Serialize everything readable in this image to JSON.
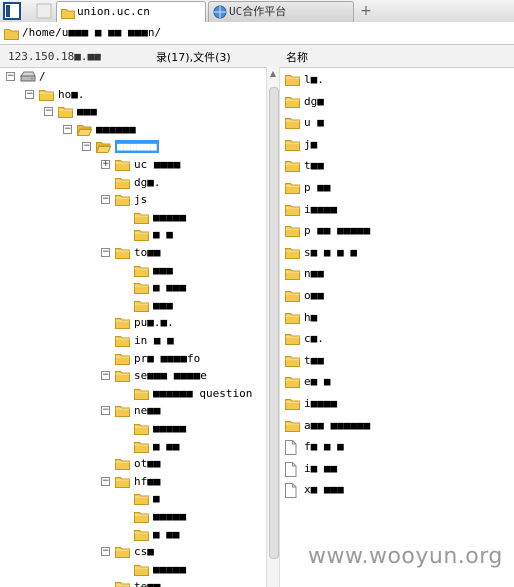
{
  "tabs": [
    {
      "label": "union.uc.cn",
      "active": true
    },
    {
      "label": "UC合作平台",
      "active": false
    }
  ],
  "new_tab_label": "+",
  "address": {
    "path": "/home/u■■■ ■ ■■ ■■■n/"
  },
  "header": {
    "ip": "123.150.18■.■■",
    "count_text": "录(17),文件(3)",
    "name_column": "名称"
  },
  "tree": [
    {
      "label": "/",
      "depth": 0,
      "toggle": "-",
      "kind": "drive"
    },
    {
      "label": "ho■.",
      "depth": 1,
      "toggle": "-",
      "kind": "folder"
    },
    {
      "label": "■■■",
      "depth": 2,
      "toggle": "-",
      "kind": "folder"
    },
    {
      "label": "■■■■■■",
      "depth": 3,
      "toggle": "-",
      "kind": "folder-open"
    },
    {
      "label": "■■■■■■",
      "depth": 4,
      "toggle": "-",
      "kind": "folder-open",
      "selected": true
    },
    {
      "label": "uc ■■■■",
      "depth": 5,
      "toggle": "+",
      "kind": "folder"
    },
    {
      "label": "dg■.",
      "depth": 5,
      "toggle": "",
      "kind": "folder"
    },
    {
      "label": "js",
      "depth": 5,
      "toggle": "-",
      "kind": "folder"
    },
    {
      "label": "■■■■■",
      "depth": 6,
      "toggle": "",
      "kind": "folder"
    },
    {
      "label": "■ ■",
      "depth": 6,
      "toggle": "",
      "kind": "folder"
    },
    {
      "label": "to■■",
      "depth": 5,
      "toggle": "-",
      "kind": "folder"
    },
    {
      "label": "■■■",
      "depth": 6,
      "toggle": "",
      "kind": "folder"
    },
    {
      "label": "■ ■■■",
      "depth": 6,
      "toggle": "",
      "kind": "folder"
    },
    {
      "label": "■■■",
      "depth": 6,
      "toggle": "",
      "kind": "folder"
    },
    {
      "label": "pu■.■.",
      "depth": 5,
      "toggle": "",
      "kind": "folder"
    },
    {
      "label": "in ■ ■",
      "depth": 5,
      "toggle": "",
      "kind": "folder"
    },
    {
      "label": "pr■ ■■■■fo",
      "depth": 5,
      "toggle": "",
      "kind": "folder"
    },
    {
      "label": "se■■■ ■■■■e",
      "depth": 5,
      "toggle": "-",
      "kind": "folder"
    },
    {
      "label": "■■■■■■ question",
      "depth": 6,
      "toggle": "",
      "kind": "folder"
    },
    {
      "label": "ne■■",
      "depth": 5,
      "toggle": "-",
      "kind": "folder"
    },
    {
      "label": "■■■■■",
      "depth": 6,
      "toggle": "",
      "kind": "folder"
    },
    {
      "label": "■ ■■",
      "depth": 6,
      "toggle": "",
      "kind": "folder"
    },
    {
      "label": "ot■■",
      "depth": 5,
      "toggle": "",
      "kind": "folder"
    },
    {
      "label": "hf■■",
      "depth": 5,
      "toggle": "-",
      "kind": "folder"
    },
    {
      "label": "■",
      "depth": 6,
      "toggle": "",
      "kind": "folder"
    },
    {
      "label": "■■■■■",
      "depth": 6,
      "toggle": "",
      "kind": "folder"
    },
    {
      "label": "■ ■■",
      "depth": 6,
      "toggle": "",
      "kind": "folder"
    },
    {
      "label": "cs■",
      "depth": 5,
      "toggle": "-",
      "kind": "folder"
    },
    {
      "label": "■■■■■",
      "depth": 6,
      "toggle": "",
      "kind": "folder"
    },
    {
      "label": "te■■",
      "depth": 5,
      "toggle": "",
      "kind": "folder"
    },
    {
      "label": "■■■■",
      "depth": 5,
      "toggle": "-",
      "kind": "folder"
    }
  ],
  "files": [
    {
      "label": "l■.",
      "kind": "folder"
    },
    {
      "label": "dg■",
      "kind": "folder"
    },
    {
      "label": "u ■",
      "kind": "folder"
    },
    {
      "label": "j■",
      "kind": "folder"
    },
    {
      "label": "t■■",
      "kind": "folder"
    },
    {
      "label": "p ■■",
      "kind": "folder"
    },
    {
      "label": "i■■■■",
      "kind": "folder"
    },
    {
      "label": "p ■■ ■■■■■",
      "kind": "folder"
    },
    {
      "label": "s■ ■ ■ ■",
      "kind": "folder"
    },
    {
      "label": "n■■",
      "kind": "folder"
    },
    {
      "label": "o■■",
      "kind": "folder"
    },
    {
      "label": "h■",
      "kind": "folder"
    },
    {
      "label": "c■.",
      "kind": "folder"
    },
    {
      "label": "t■■",
      "kind": "folder"
    },
    {
      "label": "e■ ■",
      "kind": "folder"
    },
    {
      "label": "i■■■■",
      "kind": "folder"
    },
    {
      "label": "a■■ ■■■■■■",
      "kind": "folder"
    },
    {
      "label": "f■ ■ ■",
      "kind": "file"
    },
    {
      "label": "i■ ■■",
      "kind": "file"
    },
    {
      "label": "x■ ■■■",
      "kind": "file"
    }
  ],
  "watermark": "www.wooyun.org",
  "colors": {
    "folder": "#f2c94c",
    "folder_dark": "#c9971d",
    "selection": "#3399ff",
    "watermark": "#9a9a9a"
  },
  "icons": {
    "drive": "drive-icon",
    "folder": "folder-icon",
    "file": "file-icon"
  }
}
